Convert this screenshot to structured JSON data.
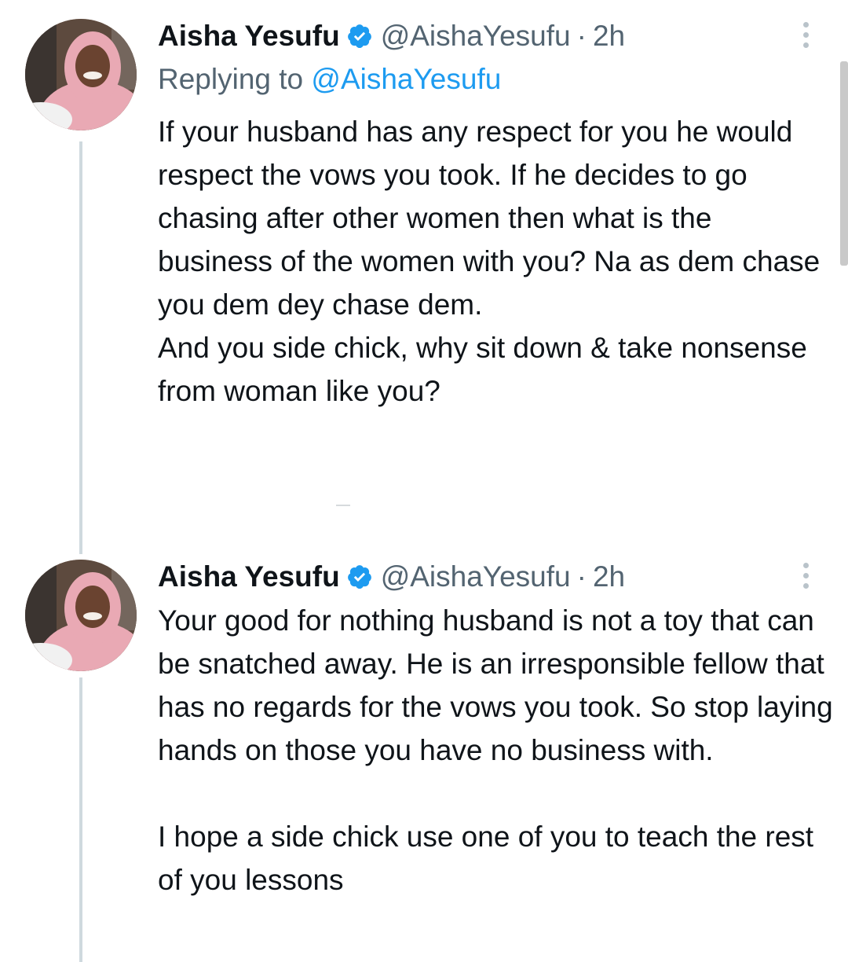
{
  "tweets": [
    {
      "name": "Aisha Yesufu",
      "handle": "@AishaYesufu",
      "separator": "·",
      "time": "2h",
      "replying_prefix": "Replying to",
      "replying_to": "@AishaYesufu",
      "text": "If your husband has any respect for you he would respect the vows you took. If he decides to go chasing after other women then what is the business of the women with you? Na as dem chase you dem dey chase dem.\nAnd you side chick, why sit down & take nonsense from woman like you?",
      "verified_icon": "verified-badge-icon",
      "more_icon": "more-options-icon"
    },
    {
      "name": "Aisha Yesufu",
      "handle": "@AishaYesufu",
      "separator": "·",
      "time": "2h",
      "text": "Your good for nothing husband is not a toy that can be snatched away. He is an irresponsible fellow that has no regards for the vows you took. So stop laying hands on those you have no business with.\n\nI hope a side chick use one of you to teach the rest of you lessons",
      "verified_icon": "verified-badge-icon",
      "more_icon": "more-options-icon"
    }
  ],
  "colors": {
    "text": "#0f1419",
    "secondary": "#536471",
    "accent": "#1d9bf0",
    "thread_line": "#cfd9de",
    "hijab_pink": "#e9a9b4"
  }
}
